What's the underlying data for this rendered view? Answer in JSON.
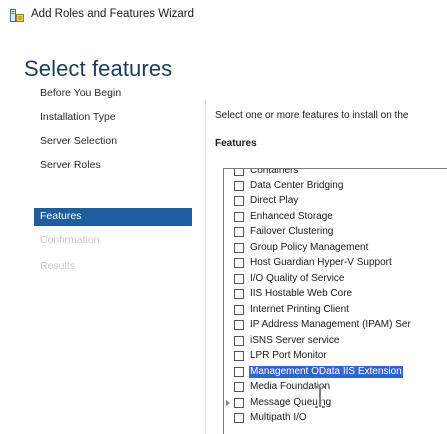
{
  "window": {
    "title": "Add Roles and Features Wizard",
    "icon": "server-manager-icon"
  },
  "page": {
    "heading": "Select features"
  },
  "nav": {
    "items": [
      {
        "label": "Before You Begin",
        "state": "normal"
      },
      {
        "label": "Installation Type",
        "state": "normal"
      },
      {
        "label": "Server Selection",
        "state": "normal"
      },
      {
        "label": "Server Roles",
        "state": "normal"
      },
      {
        "label": "Features",
        "state": "selected"
      },
      {
        "label": "Confirmation",
        "state": "disabled"
      },
      {
        "label": "Results",
        "state": "disabled"
      }
    ],
    "selected_color": "#1d5e9e"
  },
  "main": {
    "instruction": "Select one or more features to install on the",
    "features_label": "Features"
  },
  "features": {
    "highlight_color": "#3366cc",
    "items": [
      {
        "label": "Containers",
        "checked": false
      },
      {
        "label": "Data Center Bridging",
        "checked": false
      },
      {
        "label": "Direct Play",
        "checked": false
      },
      {
        "label": "Enhanced Storage",
        "checked": false
      },
      {
        "label": "Failover Clustering",
        "checked": false
      },
      {
        "label": "Group Policy Management",
        "checked": false
      },
      {
        "label": "Host Guardian Hyper-V Support",
        "checked": false
      },
      {
        "label": "I/O Quality of Service",
        "checked": false
      },
      {
        "label": "IIS Hostable Web Core",
        "checked": false
      },
      {
        "label": "Internet Printing Client",
        "checked": false
      },
      {
        "label": "IP Address Management (IPAM) Ser",
        "checked": false
      },
      {
        "label": "iSNS Server service",
        "checked": false
      },
      {
        "label": "LPR Port Monitor",
        "checked": false
      },
      {
        "label": "Management OData IIS Extension",
        "checked": false,
        "highlighted": true
      },
      {
        "label": "Media Foundation",
        "checked": false
      },
      {
        "label": "Message Queuing",
        "checked": false,
        "expandable": true
      },
      {
        "label": "Multipath I/O",
        "checked": false
      }
    ]
  }
}
